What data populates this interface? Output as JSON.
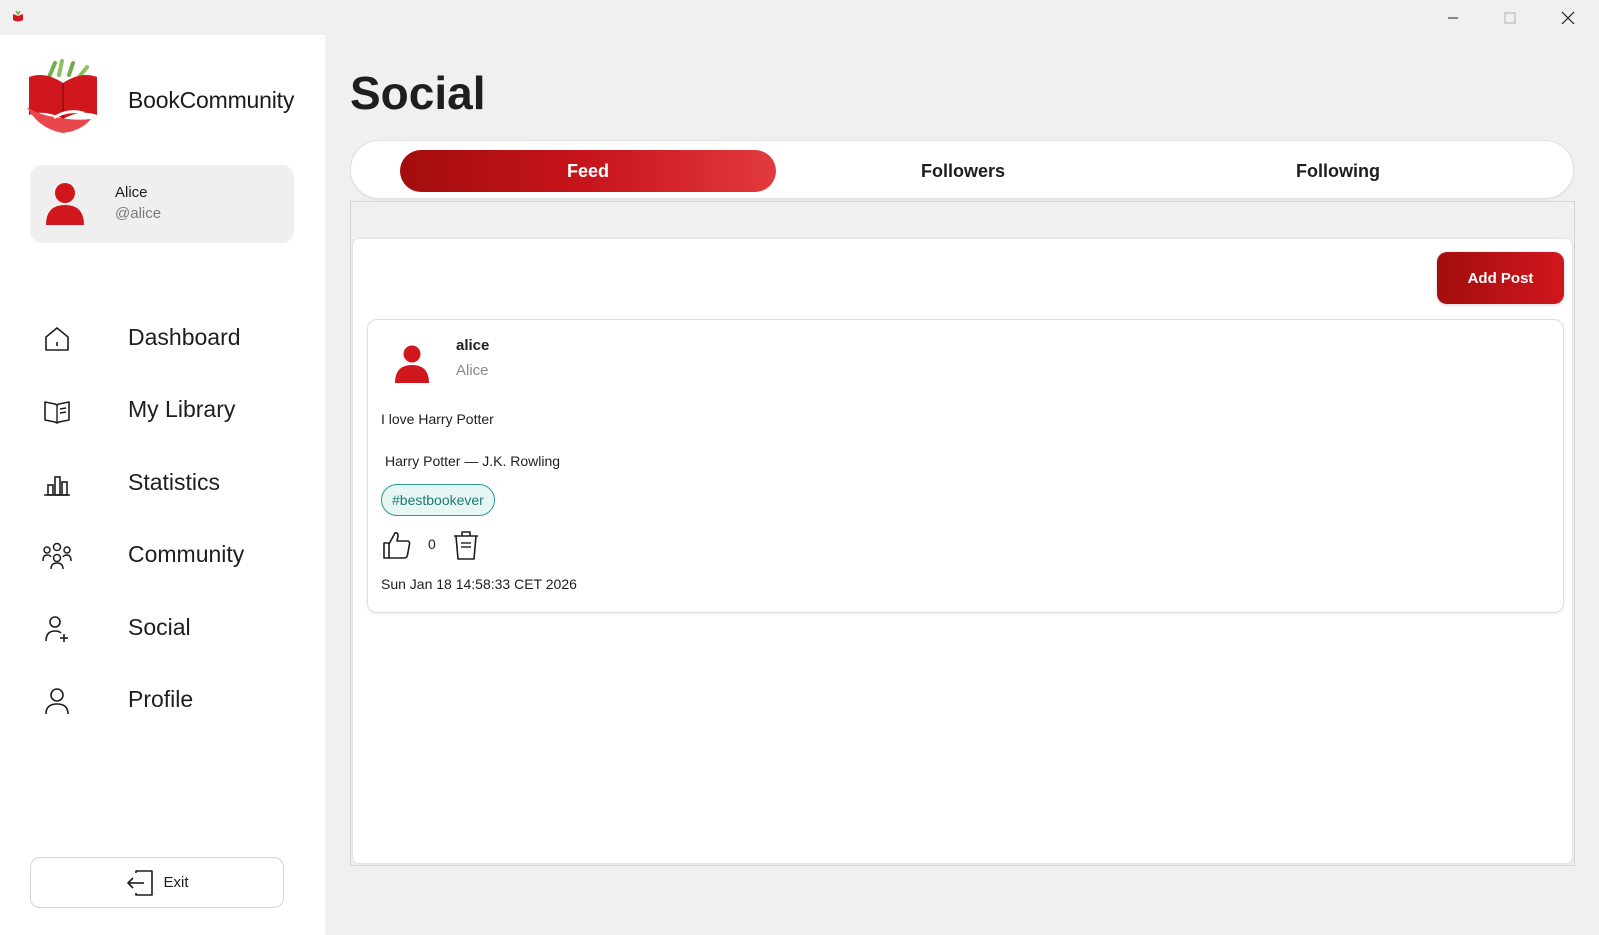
{
  "app": {
    "brand": "BookCommunity"
  },
  "user": {
    "name": "Alice",
    "handle": "@alice"
  },
  "nav": {
    "items": [
      {
        "label": "Dashboard",
        "icon": "home-icon"
      },
      {
        "label": "My Library",
        "icon": "book-icon"
      },
      {
        "label": "Statistics",
        "icon": "chart-icon"
      },
      {
        "label": "Community",
        "icon": "group-icon"
      },
      {
        "label": "Social",
        "icon": "person-add-icon"
      },
      {
        "label": "Profile",
        "icon": "person-icon"
      }
    ],
    "exit_label": "Exit"
  },
  "page": {
    "title": "Social"
  },
  "tabs": [
    {
      "label": "Feed",
      "active": true
    },
    {
      "label": "Followers",
      "active": false
    },
    {
      "label": "Following",
      "active": false
    }
  ],
  "feed": {
    "add_post_label": "Add Post",
    "posts": [
      {
        "username": "alice",
        "display_name": "Alice",
        "text": "I love Harry Potter",
        "book": "Harry Potter — J.K. Rowling",
        "tag": "#bestbookever",
        "likes": "0",
        "date": "Sun Jan 18 14:58:33 CET 2026"
      }
    ]
  },
  "colors": {
    "accent": "#c8141b",
    "accent_dark": "#a30d0d",
    "tag": "#2a9d8f"
  }
}
